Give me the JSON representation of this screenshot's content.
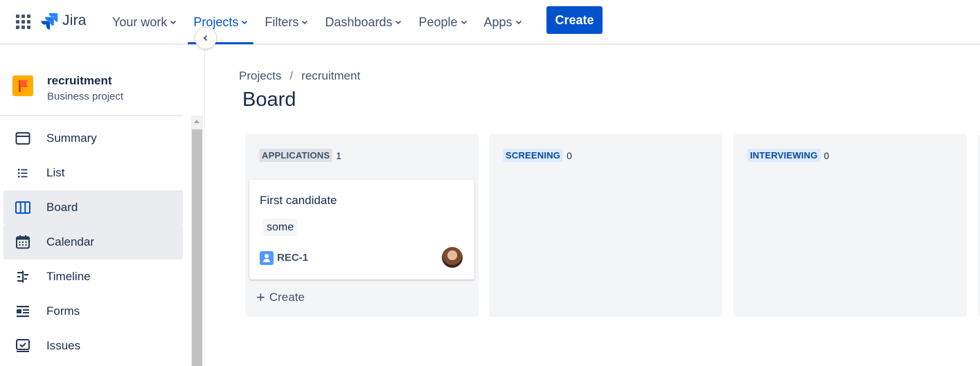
{
  "topnav": {
    "app_name": "Jira",
    "items": [
      {
        "label": "Your work",
        "active": false
      },
      {
        "label": "Projects",
        "active": true
      },
      {
        "label": "Filters",
        "active": false
      },
      {
        "label": "Dashboards",
        "active": false
      },
      {
        "label": "People",
        "active": false
      },
      {
        "label": "Apps",
        "active": false
      }
    ],
    "create_label": "Create",
    "accent_color": "#0052cc"
  },
  "sidebar": {
    "project_name": "recruitment",
    "project_type": "Business project",
    "items": [
      {
        "label": "Summary",
        "icon": "summary-icon"
      },
      {
        "label": "List",
        "icon": "list-icon"
      },
      {
        "label": "Board",
        "icon": "board-icon"
      },
      {
        "label": "Calendar",
        "icon": "calendar-icon"
      },
      {
        "label": "Timeline",
        "icon": "timeline-icon"
      },
      {
        "label": "Forms",
        "icon": "forms-icon"
      },
      {
        "label": "Issues",
        "icon": "issues-icon"
      }
    ]
  },
  "breadcrumb": {
    "root": "Projects",
    "separator": "/",
    "current": "recruitment"
  },
  "page_title": "Board",
  "board": {
    "columns": [
      {
        "name": "APPLICATIONS",
        "count": "1",
        "cards": [
          {
            "title": "First candidate",
            "label": "some",
            "key": "REC-1",
            "icon": "issue-type-person-icon"
          }
        ],
        "create_label": "Create"
      },
      {
        "name": "SCREENING",
        "count": "0",
        "cards": []
      },
      {
        "name": "INTERVIEWING",
        "count": "0",
        "cards": []
      }
    ]
  }
}
